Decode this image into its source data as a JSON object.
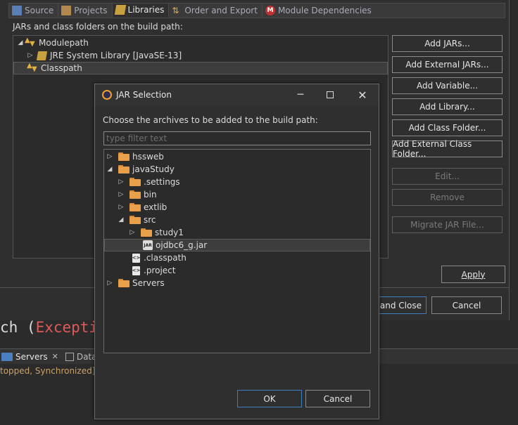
{
  "tabs": [
    {
      "label": "Source",
      "icon": "source-folder-icon",
      "active": false
    },
    {
      "label": "Projects",
      "icon": "projects-icon",
      "active": false
    },
    {
      "label": "Libraries",
      "icon": "libraries-icon",
      "active": true
    },
    {
      "label": "Order and Export",
      "icon": "order-export-icon",
      "active": false
    },
    {
      "label": "Module Dependencies",
      "icon": "module-m-icon",
      "active": false
    }
  ],
  "panel": {
    "title": "JARs and class folders on the build path:",
    "tree": [
      {
        "label": "Modulepath"
      },
      {
        "label": "JRE System Library [JavaSE-13]"
      },
      {
        "label": "Classpath"
      }
    ],
    "buttons": [
      {
        "label": "Add JARs...",
        "enabled": true
      },
      {
        "label": "Add External JARs...",
        "enabled": true
      },
      {
        "label": "Add Variable...",
        "enabled": true
      },
      {
        "label": "Add Library...",
        "enabled": true
      },
      {
        "label": "Add Class Folder...",
        "enabled": true
      },
      {
        "label": "Add External Class Folder...",
        "enabled": true
      },
      {
        "label": "Edit...",
        "enabled": false
      },
      {
        "label": "Remove",
        "enabled": false
      },
      {
        "label": "Migrate JAR File...",
        "enabled": false
      }
    ],
    "apply": "Apply",
    "apply_close": "y and Close",
    "cancel": "Cancel"
  },
  "editor": {
    "code_prefix": "ch (",
    "code_exception": "Excepti"
  },
  "servers": {
    "tab_label": "Servers",
    "other_tab": "Data",
    "status": "topped, Synchronized]"
  },
  "dialog": {
    "title": "JAR Selection",
    "prompt": "Choose the archives to be added to the build path:",
    "filter_placeholder": "type filter text",
    "tree": [
      {
        "label": "hssweb"
      },
      {
        "label": "javaStudy"
      },
      {
        "label": ".settings"
      },
      {
        "label": "bin"
      },
      {
        "label": "extlib"
      },
      {
        "label": "src"
      },
      {
        "label": "study1"
      },
      {
        "label": "ojdbc6_g.jar"
      },
      {
        "label": ".classpath"
      },
      {
        "label": ".project"
      },
      {
        "label": "Servers"
      }
    ],
    "ok": "OK",
    "cancel": "Cancel"
  },
  "colors": {
    "background": "#2f2f2f",
    "accent_border": "#3f7fc0",
    "folder": "#e8a04a",
    "exception_text": "#e05a5a"
  }
}
